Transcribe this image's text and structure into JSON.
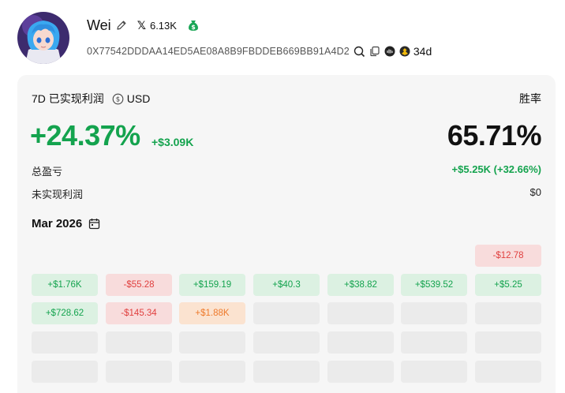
{
  "profile": {
    "name": "Wei",
    "followers": "6.13K",
    "address": "0X77542DDDAA14ED5AE08A8B9FBDDEB669BB91A4D2",
    "age": "34d",
    "icons": [
      "edit-icon",
      "x-twitter-icon",
      "money-bag-icon",
      "search-icon",
      "copy-icon",
      "chain-icon",
      "bnb-icon"
    ]
  },
  "stats": {
    "period_label": "7D 已实现利润",
    "currency": "USD",
    "winrate_label": "胜率",
    "pnl_pct": "+24.37%",
    "pnl_usd": "+$3.09K",
    "winrate": "65.71%",
    "total_label": "总盈亏",
    "total_value": "+$5.25K (+32.66%)",
    "unrealized_label": "未实现利润",
    "unrealized_value": "$0"
  },
  "calendar": {
    "month": "Mar 2026",
    "rows": [
      [
        null,
        null,
        null,
        null,
        null,
        null,
        {
          "text": "-$12.78",
          "tone": "neg"
        }
      ],
      [
        {
          "text": "+$1.76K",
          "tone": "pos"
        },
        {
          "text": "-$55.28",
          "tone": "neg"
        },
        {
          "text": "+$159.19",
          "tone": "pos"
        },
        {
          "text": "+$40.3",
          "tone": "pos"
        },
        {
          "text": "+$38.82",
          "tone": "pos"
        },
        {
          "text": "+$539.52",
          "tone": "pos"
        },
        {
          "text": "+$5.25",
          "tone": "pos"
        }
      ],
      [
        {
          "text": "+$728.62",
          "tone": "pos"
        },
        {
          "text": "-$145.34",
          "tone": "neg"
        },
        {
          "text": "+$1.88K",
          "tone": "warn"
        },
        {
          "tone": "empty"
        },
        {
          "tone": "empty"
        },
        {
          "tone": "empty"
        },
        {
          "tone": "empty"
        }
      ],
      [
        {
          "tone": "empty"
        },
        {
          "tone": "empty"
        },
        {
          "tone": "empty"
        },
        {
          "tone": "empty"
        },
        {
          "tone": "empty"
        },
        {
          "tone": "empty"
        },
        {
          "tone": "empty"
        }
      ],
      [
        {
          "tone": "empty"
        },
        {
          "tone": "empty"
        },
        {
          "tone": "empty"
        },
        {
          "tone": "empty"
        },
        {
          "tone": "empty"
        },
        {
          "tone": "empty"
        },
        {
          "tone": "empty"
        }
      ]
    ]
  },
  "colors": {
    "positive": "#14a34e",
    "negative": "#e0403f",
    "warning": "#ee7a2b"
  }
}
